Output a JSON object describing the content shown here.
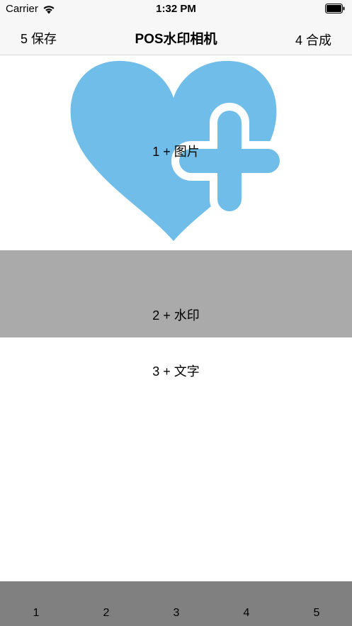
{
  "status_bar": {
    "carrier": "Carrier",
    "time": "1:32 PM"
  },
  "nav": {
    "left_label": "5 保存",
    "title": "POS水印相机",
    "right_label": "4 合成"
  },
  "image_area": {
    "label": "1 + 图片",
    "heart_color": "#6fbde8"
  },
  "watermark_area": {
    "label": "2 + 水印",
    "background": "#aaaaaa"
  },
  "text_area": {
    "label": "3 + 文字"
  },
  "bottom_bar": {
    "background": "#808080",
    "tabs": [
      "1",
      "2",
      "3",
      "4",
      "5"
    ]
  },
  "icons": [
    "wifi-icon",
    "battery-icon",
    "heart-add-icon"
  ]
}
